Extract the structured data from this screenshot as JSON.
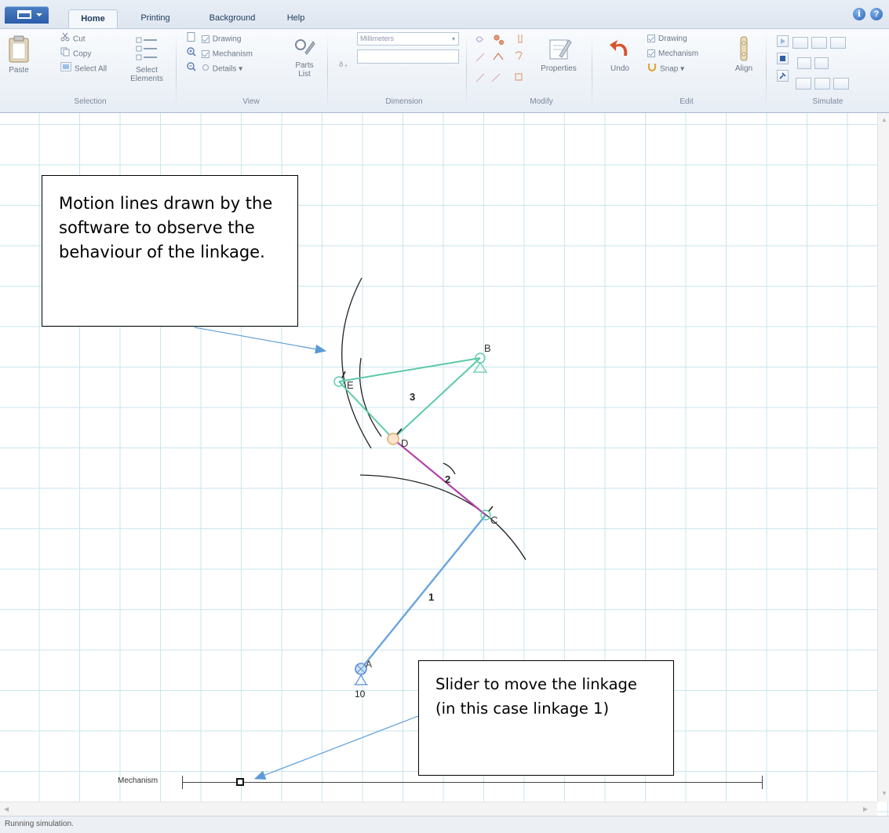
{
  "tabs": {
    "home": "Home",
    "printing": "Printing",
    "background": "Background",
    "help": "Help"
  },
  "ribbon": {
    "selection": {
      "label": "Selection",
      "paste": "Paste",
      "cut": "Cut",
      "copy": "Copy",
      "select_all": "Select All",
      "select_elements": "Select Elements"
    },
    "view": {
      "label": "View",
      "drawing": "Drawing",
      "mechanism": "Mechanism",
      "details": "Details",
      "parts_list": "Parts List"
    },
    "dimension": {
      "label": "Dimension",
      "units": "Millimeters",
      "value": ""
    },
    "modify": {
      "label": "Modify",
      "properties": "Properties"
    },
    "edit": {
      "label": "Edit",
      "undo": "Undo",
      "drawing": "Drawing",
      "mechanism": "Mechanism",
      "snap": "Snap",
      "align": "Align"
    },
    "simulate": {
      "label": "Simulate"
    }
  },
  "canvas": {
    "points": {
      "A": "A",
      "B": "B",
      "C": "C",
      "D": "D",
      "E": "E"
    },
    "links": {
      "link1": "1",
      "link2": "2",
      "link3": "3"
    },
    "ground_id": "10",
    "colors": {
      "link1": "#6aa4dd",
      "link2": "#b23fa8",
      "link3": "#5ccaa8",
      "grid": "#c9e6ee",
      "arrow": "#5b9bd5"
    }
  },
  "callouts": {
    "motion_lines": "Motion lines drawn by the software to observe the behaviour of the linkage.",
    "slider": "Slider to move the linkage (in this case linkage 1)"
  },
  "slider": {
    "label": "Mechanism",
    "position": 0.1
  },
  "status": {
    "text": "Running simulation."
  }
}
